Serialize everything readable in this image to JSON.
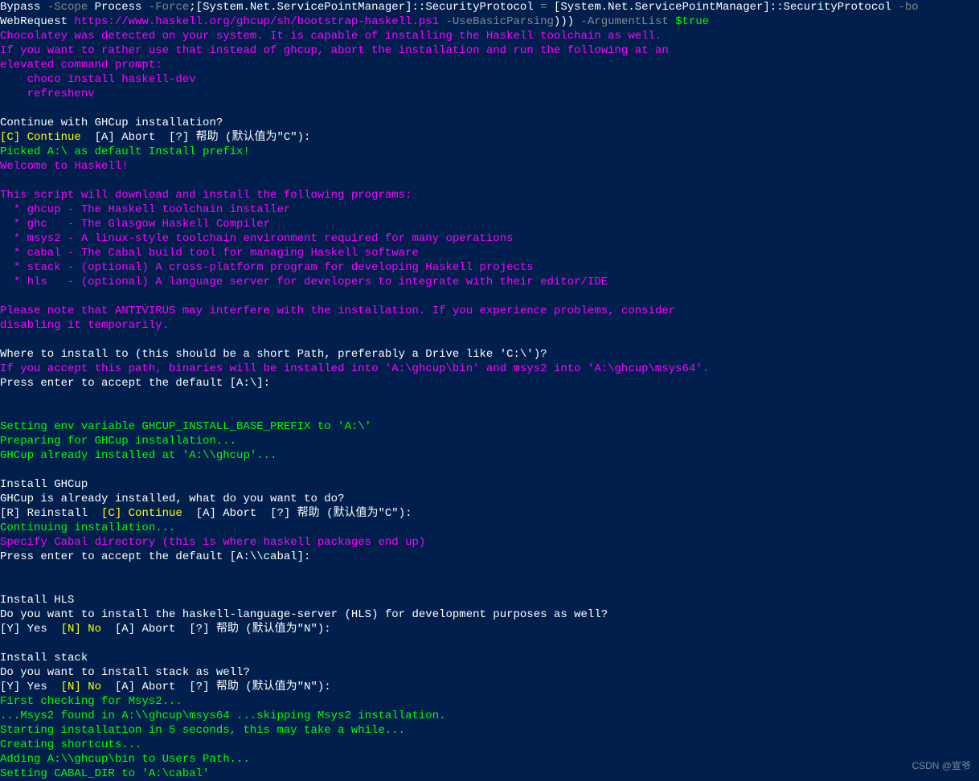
{
  "line1": {
    "a": "Bypass ",
    "b": "-Scope ",
    "c": "Process ",
    "d": "-Force",
    "e": ";[System.Net.ServicePointManager]::SecurityProtocol ",
    "f": "= ",
    "g": "[System.Net.ServicePointManager]::SecurityProtocol ",
    "h": "-bo"
  },
  "line2": {
    "a": "WebRequest ",
    "b": "https://www.haskell.org/ghcup/sh/bootstrap-haskell.ps1 ",
    "c": "-UseBasicParsing",
    "d": "))) ",
    "e": "-ArgumentList ",
    "f": "$true"
  },
  "choco1": "Chocolatey was detected on your system. It is capable of installing the Haskell toolchain as well.",
  "choco2": "If you want to rather use that instead of ghcup, abort the installation and run the following at an",
  "choco3": "elevated command prompt:",
  "choco4": "    choco install haskell-dev",
  "choco5": "    refreshenv",
  "cont1": "Continue with GHCup installation?",
  "cont2a": "[C] Continue",
  "cont2b": "  [A] Abort  [?] 帮助 (默认值为\"C\"): ",
  "picked": "Picked A:\\ as default Install prefix!",
  "welcome": "Welcome to Haskell!",
  "script1": "This script will download and install the following programs:",
  "script2": "  * ghcup - The Haskell toolchain installer",
  "script3": "  * ghc   - The Glasgow Haskell Compiler",
  "script4": "  * msys2 - A linux-style toolchain environment required for many operations",
  "script5": "  * cabal - The Cabal build tool for managing Haskell software",
  "script6": "  * stack - (optional) A cross-platform program for developing Haskell projects",
  "script7": "  * hls   - (optional) A language server for developers to integrate with their editor/IDE",
  "antivirus1": "Please note that ANTIVIRUS may interfere with the installation. If you experience problems, consider",
  "antivirus2": "disabling it temporarily.",
  "where1": "Where to install to (this should be a short Path, preferably a Drive like 'C:\\')?",
  "where2": "If you accept this path, binaries will be installed into 'A:\\ghcup\\bin' and msys2 into 'A:\\ghcup\\msys64'.",
  "where3": "Press enter to accept the default [A:\\]:",
  "setenv": "Setting env variable GHCUP_INSTALL_BASE_PREFIX to 'A:\\'",
  "prep": "Preparing for GHCup installation...",
  "already": "GHCup already installed at 'A:\\\\ghcup'...",
  "instghcup": "Install GHCup",
  "ghcupalready": "GHCup is already installed, what do you want to do?",
  "reinstall_a": "[R] Reinstall  ",
  "reinstall_b": "[C] Continue",
  "reinstall_c": "  [A] Abort  [?] 帮助 (默认值为\"C\"): ",
  "contInst": "Continuing installation...",
  "cabal1": "Specify Cabal directory (this is where haskell packages end up)",
  "cabal2": "Press enter to accept the default [A:\\\\cabal]:",
  "hls1": "Install HLS",
  "hls2": "Do you want to install the haskell-language-server (HLS) for development purposes as well?",
  "hls3a": "[Y] Yes  ",
  "hls3b": "[N] No",
  "hls3c": "  [A] Abort  [?] 帮助 (默认值为\"N\"): ",
  "stack1": "Install stack",
  "stack2": "Do you want to install stack as well?",
  "stack3a": "[Y] Yes  ",
  "stack3b": "[N] No",
  "stack3c": "  [A] Abort  [?] 帮助 (默认值为\"N\"): ",
  "msys1": "First checking for Msys2...",
  "msys2": "...Msys2 found in A:\\\\ghcup\\msys64 ...skipping Msys2 installation.",
  "start1": "Starting installation in 5 seconds, this may take a while...",
  "short1": "Creating shortcuts...",
  "path1": "Adding A:\\\\ghcup\\bin to Users Path...",
  "setcabal": "Setting CABAL_DIR to 'A:\\cabal'",
  "watermark": "CSDN @宣爷"
}
